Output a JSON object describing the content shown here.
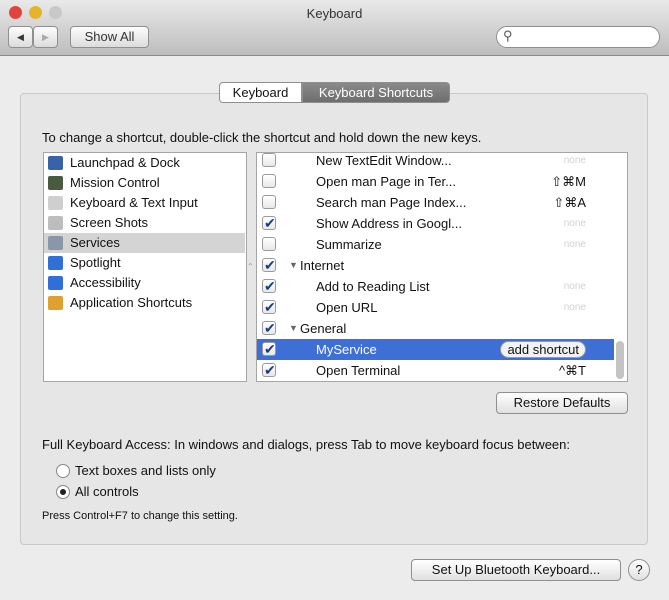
{
  "window": {
    "title": "Keyboard"
  },
  "toolbar": {
    "back": "◀",
    "forward": "▶",
    "show_all": "Show All",
    "search_placeholder": ""
  },
  "tabs": [
    {
      "label": "Keyboard",
      "selected": false
    },
    {
      "label": "Keyboard Shortcuts",
      "selected": true
    }
  ],
  "instructions": "To change a shortcut, double-click the shortcut and hold down the new keys.",
  "categories": [
    {
      "label": "Launchpad & Dock",
      "icon": "launchpad-icon",
      "color": "#3a62a8"
    },
    {
      "label": "Mission Control",
      "icon": "mission-control-icon",
      "color": "#4a5a40"
    },
    {
      "label": "Keyboard & Text Input",
      "icon": "keyboard-icon",
      "color": "#cfcfcf"
    },
    {
      "label": "Screen Shots",
      "icon": "camera-icon",
      "color": "#bdbdbd"
    },
    {
      "label": "Services",
      "icon": "gear-icon",
      "color": "#8a97a8",
      "selected": true
    },
    {
      "label": "Spotlight",
      "icon": "spotlight-icon",
      "color": "#2f6fd6"
    },
    {
      "label": "Accessibility",
      "icon": "accessibility-icon",
      "color": "#2f6fd6"
    },
    {
      "label": "Application Shortcuts",
      "icon": "app-shortcuts-icon",
      "color": "#e0a030"
    }
  ],
  "shortcuts": [
    {
      "label": "New TextEdit Window...",
      "checked": false,
      "shortcut": "none",
      "indent": true
    },
    {
      "label": "Open man Page in Ter...",
      "checked": false,
      "shortcut": "⇧⌘M",
      "indent": true
    },
    {
      "label": "Search man Page Index...",
      "checked": false,
      "shortcut": "⇧⌘A",
      "indent": true
    },
    {
      "label": "Show Address in Googl...",
      "checked": true,
      "shortcut": "none",
      "indent": true
    },
    {
      "label": "Summarize",
      "checked": false,
      "shortcut": "none",
      "indent": true
    },
    {
      "label": "Internet",
      "checked": true,
      "shortcut": "",
      "group": true
    },
    {
      "label": "Add to Reading List",
      "checked": true,
      "shortcut": "none",
      "indent": true
    },
    {
      "label": "Open URL",
      "checked": true,
      "shortcut": "none",
      "indent": true
    },
    {
      "label": "General",
      "checked": true,
      "shortcut": "",
      "group": true
    },
    {
      "label": "MyService",
      "checked": true,
      "shortcut": "add shortcut",
      "indent": true,
      "selected": true
    },
    {
      "label": "Open Terminal",
      "checked": true,
      "shortcut": "^⌘T",
      "indent": true
    }
  ],
  "restore_defaults": "Restore Defaults",
  "fka": {
    "label": "Full Keyboard Access: In windows and dialogs, press Tab to move keyboard focus between:",
    "options": [
      {
        "label": "Text boxes and lists only",
        "selected": false
      },
      {
        "label": "All controls",
        "selected": true
      }
    ],
    "hint": "Press Control+F7 to change this setting."
  },
  "bluetooth": "Set Up Bluetooth Keyboard...",
  "help": "?"
}
